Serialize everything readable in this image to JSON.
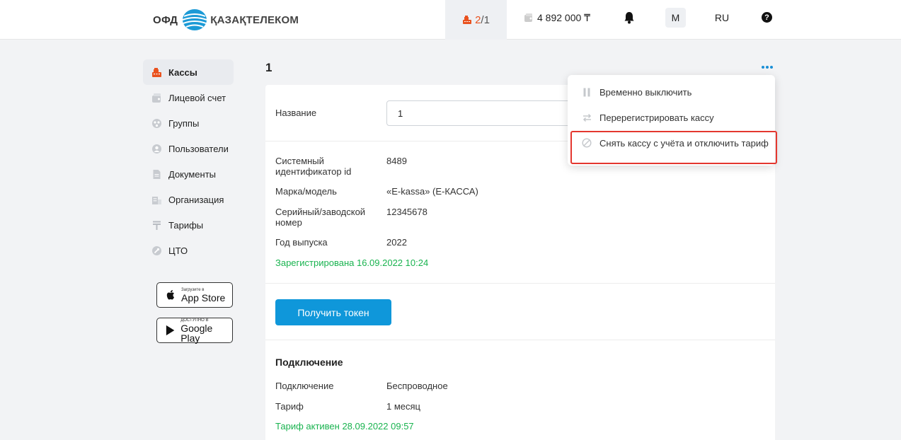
{
  "header": {
    "logo_ofd": "ОФД",
    "logo_company": "ҚАЗАҚТЕЛЕКОМ",
    "kassy_active": "2",
    "kassy_total": "/1",
    "balance": "4 892 000 ₸",
    "user_initial": "М",
    "language": "RU",
    "help": "?"
  },
  "sidebar": {
    "items": [
      {
        "label": "Кассы",
        "icon": "cash-register-icon"
      },
      {
        "label": "Лицевой счет",
        "icon": "wallet-icon"
      },
      {
        "label": "Группы",
        "icon": "groups-icon"
      },
      {
        "label": "Пользователи",
        "icon": "user-icon"
      },
      {
        "label": "Документы",
        "icon": "document-icon"
      },
      {
        "label": "Организация",
        "icon": "building-icon"
      },
      {
        "label": "Тарифы",
        "icon": "tenge-icon"
      },
      {
        "label": "ЦТО",
        "icon": "wrench-icon"
      }
    ],
    "app_store": {
      "small": "Загрузите в",
      "big": "App Store"
    },
    "google_play": {
      "small": "ДОСТУПНО В",
      "big": "Google Play"
    }
  },
  "main": {
    "title": "1",
    "name_label": "Название",
    "name_value": "1",
    "details": [
      {
        "label": "Системный идентификатор id",
        "value": "8489"
      },
      {
        "label": "Марка/модель",
        "value": "«E-kassa» (E-КАССА)"
      },
      {
        "label": "Серийный/заводской номер",
        "value": "12345678"
      },
      {
        "label": "Год выпуска",
        "value": "2022"
      }
    ],
    "registered_status": "Зарегистрирована 16.09.2022 10:24",
    "token_button": "Получить токен",
    "connection": {
      "title": "Подключение",
      "rows": [
        {
          "label": "Подключение",
          "value": "Беспроводное"
        },
        {
          "label": "Тариф",
          "value": "1 месяц"
        }
      ],
      "tariff_status": "Тариф активен 28.09.2022 09:57"
    }
  },
  "dropdown": {
    "items": [
      {
        "label": "Временно выключить",
        "icon": "pause-icon"
      },
      {
        "label": "Перерегистрировать кассу",
        "icon": "re-register-icon"
      },
      {
        "label": "Снять кассу с учёта и отключить тариф",
        "icon": "deregister-icon"
      }
    ]
  },
  "colors": {
    "accent_blue": "#0f97da",
    "status_green": "#19b34f",
    "cash_register_orange": "#e9521f",
    "highlight_red": "#e4372f"
  }
}
